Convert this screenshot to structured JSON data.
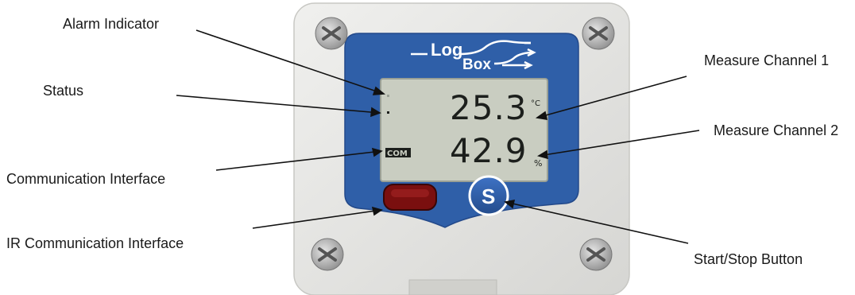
{
  "device": {
    "brand_top": "Log",
    "brand_bottom": "Box",
    "channel1_value": "25.3",
    "channel1_unit": "°C",
    "channel2_value": "42.9",
    "channel2_unit": "%",
    "com_indicator": "COM",
    "button_label": "S"
  },
  "labels": {
    "alarm_indicator": "Alarm Indicator",
    "status": "Status",
    "communication_interface": "Communication Interface",
    "ir_communication_interface": "IR Communication Interface",
    "measure_channel_1": "Measure Channel 1",
    "measure_channel_2": "Measure Channel 2",
    "start_stop_button": "Start/Stop Button"
  },
  "colors": {
    "housing": "#e7e7e5",
    "faceplate": "#2f5fa8",
    "lcd": "#c9cdc1",
    "lcd_segments": "#1c1f1c",
    "ir_window": "#7a0f0f",
    "button": "#2f5fa8"
  }
}
